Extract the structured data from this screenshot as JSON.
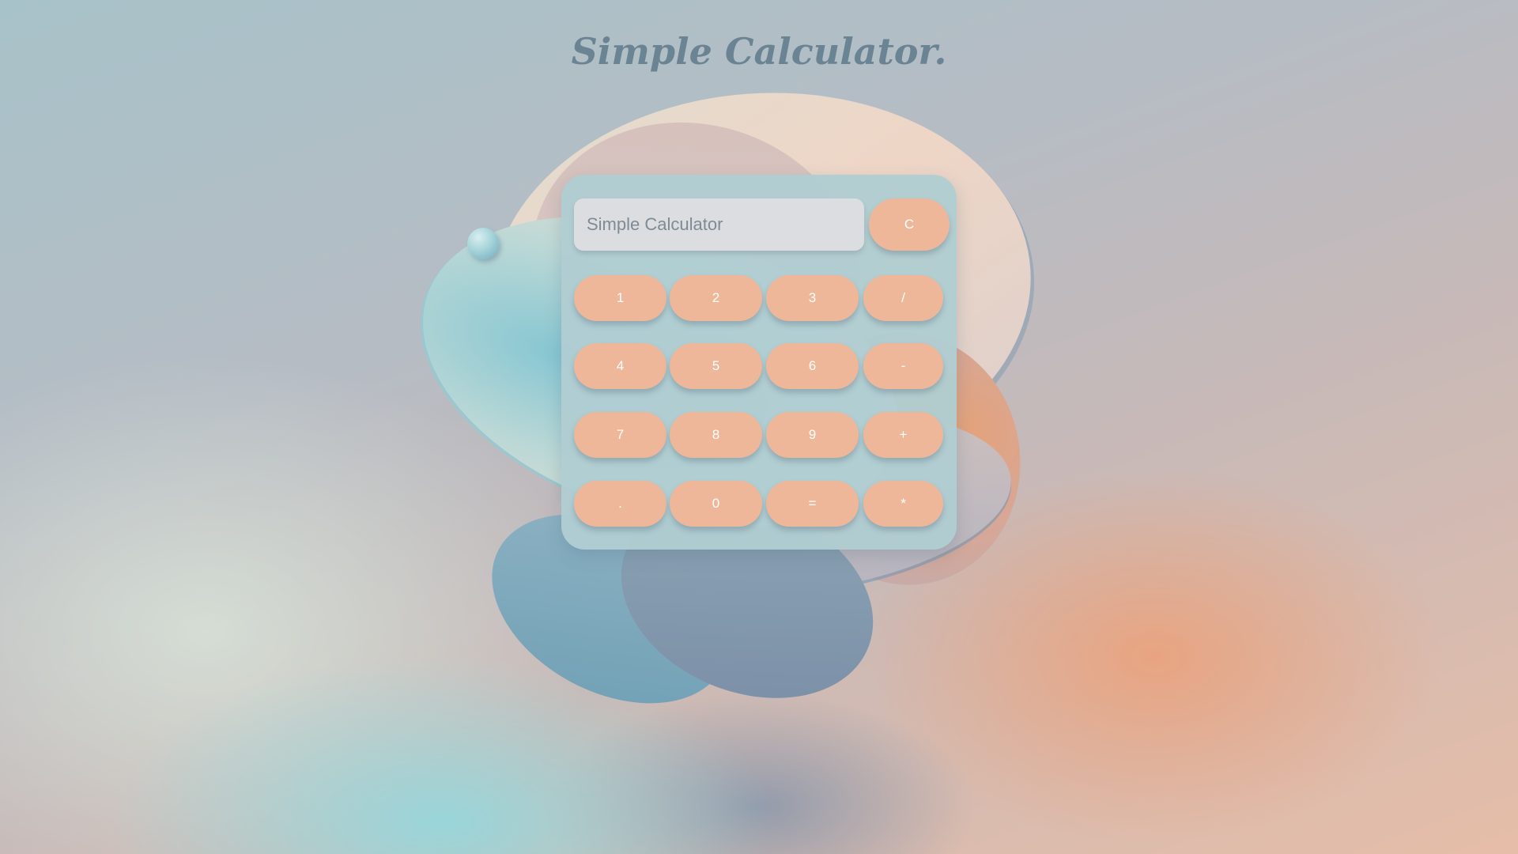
{
  "page": {
    "title": "Simple Calculator."
  },
  "calculator": {
    "display_placeholder": "Simple Calculator",
    "clear_label": "C",
    "keys": [
      [
        "1",
        "2",
        "3",
        "/"
      ],
      [
        "4",
        "5",
        "6",
        "-"
      ],
      [
        "7",
        "8",
        "9",
        "+"
      ],
      [
        ".",
        "0",
        "=",
        "*"
      ]
    ]
  },
  "colors": {
    "key_fill": "#efb799",
    "calculator_body": "#b0cdd1",
    "title_text": "#6b8494"
  }
}
